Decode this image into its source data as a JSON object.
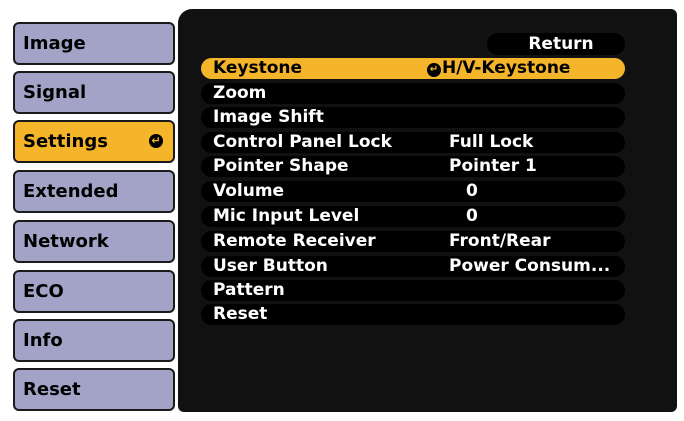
{
  "tabs": [
    {
      "label": "Image"
    },
    {
      "label": "Signal"
    },
    {
      "label": "Settings",
      "active": true
    },
    {
      "label": "Extended"
    },
    {
      "label": "Network"
    },
    {
      "label": "ECO"
    },
    {
      "label": "Info"
    },
    {
      "label": "Reset"
    }
  ],
  "enter_icon": "↵",
  "return_label": "Return",
  "items": [
    {
      "label": "Keystone",
      "value": "H/V-Keystone",
      "selected": true
    },
    {
      "label": "Zoom",
      "value": ""
    },
    {
      "label": "Image Shift",
      "value": ""
    },
    {
      "label": "Control Panel Lock",
      "value": "Full Lock"
    },
    {
      "label": "Pointer Shape",
      "value": "Pointer 1"
    },
    {
      "label": "Volume",
      "value": "0"
    },
    {
      "label": "Mic Input Level",
      "value": "0"
    },
    {
      "label": "Remote Receiver",
      "value": "Front/Rear"
    },
    {
      "label": "User Button",
      "value": "Power Consum..."
    },
    {
      "label": "Pattern",
      "value": ""
    },
    {
      "label": "Reset",
      "value": ""
    }
  ],
  "colors": {
    "highlight": "#f5b52a",
    "tab": "#a3a3c7",
    "panel": "#111111"
  }
}
